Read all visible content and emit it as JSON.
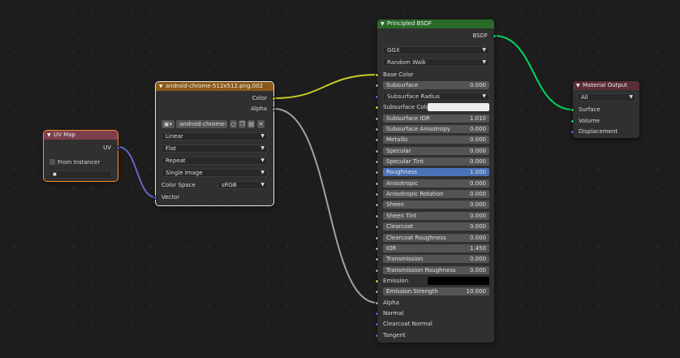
{
  "colors": {
    "uvmap_header": "#7d3f4e",
    "texture_header": "#8b5a18",
    "shader_header": "#2a6a29",
    "output_header": "#5a2c34",
    "wire_color": "#c7c729",
    "wire_alpha": "#a1a1a1",
    "wire_vector": "#6363c7",
    "wire_bsdf": "#00d660",
    "active_field": "#4a72b8"
  },
  "uvmap": {
    "title": "UV Map",
    "output_uv": "UV",
    "from_instancer": "From Instancer",
    "uv_value": ""
  },
  "texture": {
    "title": "android-chrome-512x512.png.002",
    "out_color": "Color",
    "out_alpha": "Alpha",
    "image_name": "android-chrome-5...",
    "interpolation": "Linear",
    "projection": "Flat",
    "extension": "Repeat",
    "source": "Single Image",
    "colorspace_label": "Color Space",
    "colorspace": "sRGB",
    "in_vector": "Vector"
  },
  "bsdf": {
    "title": "Principled BSDF",
    "out_bsdf": "BSDF",
    "distribution": "GGX",
    "subsurface_method": "Random Walk",
    "base_color": "Base Color",
    "fields": [
      {
        "label": "Subsurface",
        "value": "0.000"
      },
      {
        "label": "Subsurface Radius",
        "value": ""
      },
      {
        "label": "Subsurface Colo",
        "value": ""
      },
      {
        "label": "Subsurface IOR",
        "value": "1.010"
      },
      {
        "label": "Subsurface Anisotropy",
        "value": "0.000"
      },
      {
        "label": "Metallic",
        "value": "0.000"
      },
      {
        "label": "Specular",
        "value": "0.000"
      },
      {
        "label": "Specular Tint",
        "value": "0.000"
      },
      {
        "label": "Roughness",
        "value": "1.000"
      },
      {
        "label": "Anisotropic",
        "value": "0.000"
      },
      {
        "label": "Anisotropic Rotation",
        "value": "0.000"
      },
      {
        "label": "Sheen",
        "value": "0.000"
      },
      {
        "label": "Sheen Tint",
        "value": "0.000"
      },
      {
        "label": "Clearcoat",
        "value": "0.000"
      },
      {
        "label": "Clearcoat Roughness",
        "value": "0.000"
      },
      {
        "label": "IOR",
        "value": "1.450"
      },
      {
        "label": "Transmission",
        "value": "0.000"
      },
      {
        "label": "Transmission Roughness",
        "value": "0.000"
      },
      {
        "label": "Emission",
        "value": ""
      },
      {
        "label": "Emission Strength",
        "value": "10.000"
      }
    ],
    "alpha": "Alpha",
    "normal": "Normal",
    "clearcoat_normal": "Clearcoat Normal",
    "tangent": "Tangent"
  },
  "output": {
    "title": "Material Output",
    "target": "All",
    "surface": "Surface",
    "volume": "Volume",
    "displacement": "Displacement"
  }
}
